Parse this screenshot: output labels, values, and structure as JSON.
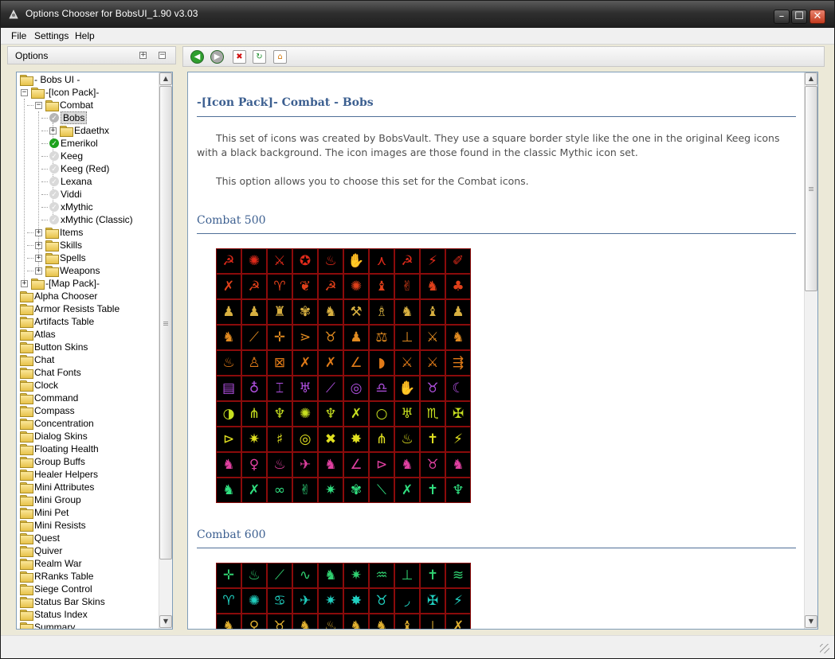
{
  "window": {
    "title": "Options Chooser for BobsUI_1.90 v3.03",
    "buttons": {
      "minimize": "–",
      "maximize": "☐",
      "close": "✕"
    }
  },
  "menu": [
    "File",
    "Settings",
    "Help"
  ],
  "left_panel": {
    "header": "Options",
    "expand_symbol": "+",
    "collapse_symbol": "−",
    "tree": [
      {
        "label": "- Bobs UI -",
        "level": 0
      },
      {
        "label": "-[Icon Pack]-",
        "level": 0,
        "expander": "−"
      },
      {
        "label": "Combat",
        "level": 1,
        "expander": "−"
      },
      {
        "label": "Bobs",
        "level": 2,
        "check": "grey",
        "selected": true
      },
      {
        "label": "Edaethx",
        "level": 2,
        "expander": "+",
        "folder": true
      },
      {
        "label": "Emerikol",
        "level": 2,
        "check": "green"
      },
      {
        "label": "Keeg",
        "level": 2,
        "check": "faint"
      },
      {
        "label": "Keeg (Red)",
        "level": 2,
        "check": "faint"
      },
      {
        "label": "Lexana",
        "level": 2,
        "check": "faint"
      },
      {
        "label": "Viddi",
        "level": 2,
        "check": "faint"
      },
      {
        "label": "xMythic",
        "level": 2,
        "check": "faint"
      },
      {
        "label": "xMythic (Classic)",
        "level": 2,
        "check": "faint"
      },
      {
        "label": "Items",
        "level": 1,
        "expander": "+"
      },
      {
        "label": "Skills",
        "level": 1,
        "expander": "+"
      },
      {
        "label": "Spells",
        "level": 1,
        "expander": "+"
      },
      {
        "label": "Weapons",
        "level": 1,
        "expander": "+"
      },
      {
        "label": "-[Map Pack]-",
        "level": 0,
        "expander": "+"
      },
      {
        "label": "Alpha Chooser",
        "level": 0
      },
      {
        "label": "Armor Resists Table",
        "level": 0
      },
      {
        "label": "Artifacts Table",
        "level": 0
      },
      {
        "label": "Atlas",
        "level": 0
      },
      {
        "label": "Button Skins",
        "level": 0
      },
      {
        "label": "Chat",
        "level": 0
      },
      {
        "label": "Chat Fonts",
        "level": 0
      },
      {
        "label": "Clock",
        "level": 0
      },
      {
        "label": "Command",
        "level": 0
      },
      {
        "label": "Compass",
        "level": 0
      },
      {
        "label": "Concentration",
        "level": 0
      },
      {
        "label": "Dialog Skins",
        "level": 0
      },
      {
        "label": "Floating Health",
        "level": 0
      },
      {
        "label": "Group Buffs",
        "level": 0
      },
      {
        "label": "Healer Helpers",
        "level": 0
      },
      {
        "label": "Mini Attributes",
        "level": 0
      },
      {
        "label": "Mini Group",
        "level": 0
      },
      {
        "label": "Mini Pet",
        "level": 0
      },
      {
        "label": "Mini Resists",
        "level": 0
      },
      {
        "label": "Quest",
        "level": 0
      },
      {
        "label": "Quiver",
        "level": 0
      },
      {
        "label": "Realm War",
        "level": 0
      },
      {
        "label": "RRanks Table",
        "level": 0
      },
      {
        "label": "Siege Control",
        "level": 0
      },
      {
        "label": "Status Bar Skins",
        "level": 0
      },
      {
        "label": "Status Index",
        "level": 0
      },
      {
        "label": "Summary",
        "level": 0
      }
    ]
  },
  "toolbar": [
    {
      "name": "back-icon",
      "glyph": "◀",
      "color": "#2e9e2e"
    },
    {
      "name": "forward-icon",
      "glyph": "▶",
      "color": "#a8a8a8"
    },
    {
      "name": "stop-icon",
      "glyph": "✖",
      "color": "#d01010"
    },
    {
      "name": "refresh-icon",
      "glyph": "↻",
      "color": "#1f8f2f"
    },
    {
      "name": "home-icon",
      "glyph": "⌂",
      "color": "#d47a10"
    }
  ],
  "content": {
    "title": "-[Icon Pack]- Combat - Bobs",
    "paragraph1": "This set of icons was created by BobsVault. They use a square border style like the one in the original Keeg icons with a black background. The icon images are those found in the classic Mythic icon set.",
    "paragraph2": "This option allows you to choose this set for the Combat icons.",
    "section1": "Combat 500",
    "section2": "Combat 600"
  },
  "icon_grid_1": {
    "rows": [
      {
        "color": "#e02a1a",
        "glyphs": [
          "☭",
          "✺",
          "⚔",
          "✪",
          "♨",
          "✋",
          "⋏",
          "☭",
          "⚡",
          "✐"
        ]
      },
      {
        "color": "#e0401a",
        "glyphs": [
          "✗",
          "☭",
          "♈",
          "❦",
          "☭",
          "✺",
          "♝",
          "✌",
          "♞",
          "♣"
        ]
      },
      {
        "color": "#d8b040",
        "glyphs": [
          "♟",
          "♟",
          "♜",
          "✾",
          "♞",
          "⚒",
          "♗",
          "♞",
          "♝",
          "♟"
        ]
      },
      {
        "color": "#e08a20",
        "glyphs": [
          "♞",
          "⟋",
          "✛",
          "⋗",
          "♉",
          "♟",
          "⚖",
          "⊥",
          "⚔",
          "♞"
        ]
      },
      {
        "color": "#e07a18",
        "glyphs": [
          "♨",
          "♙",
          "⊠",
          "✗",
          "✗",
          "∠",
          "◗",
          "⚔",
          "⚔",
          "⇶"
        ]
      },
      {
        "color": "#b050e0",
        "glyphs": [
          "▤",
          "♁",
          "⌶",
          "♅",
          "⟋",
          "◎",
          "♎",
          "✋",
          "♉",
          "☾"
        ]
      },
      {
        "color": "#c8e020",
        "glyphs": [
          "◑",
          "⋔",
          "♆",
          "✺",
          "♆",
          "✗",
          "○",
          "♅",
          "♏",
          "✠"
        ]
      },
      {
        "color": "#e0e020",
        "glyphs": [
          "⊳",
          "✷",
          "♯",
          "◎",
          "✖",
          "✸",
          "⋔",
          "♨",
          "✝",
          "⚡"
        ]
      },
      {
        "color": "#e040a0",
        "glyphs": [
          "♞",
          "♀",
          "♨",
          "✈",
          "♞",
          "∠",
          "⊳",
          "♞",
          "♉",
          "♞"
        ]
      },
      {
        "color": "#30e080",
        "glyphs": [
          "♞",
          "✗",
          "∞",
          "✌",
          "✷",
          "✾",
          "⟍",
          "✗",
          "✝",
          "♆"
        ]
      }
    ]
  },
  "icon_grid_2": {
    "rows": [
      {
        "color": "#30d070",
        "glyphs": [
          "✛",
          "♨",
          "⟋",
          "∿",
          "♞",
          "✷",
          "♒",
          "⊥",
          "✝",
          "≋"
        ]
      },
      {
        "color": "#20d0c0",
        "glyphs": [
          "♈",
          "✺",
          "♋",
          "✈",
          "✷",
          "✸",
          "♉",
          "◞",
          "✠",
          "⚡"
        ]
      },
      {
        "color": "#e0b030",
        "glyphs": [
          "♞",
          "♀",
          "♉",
          "♞",
          "♨",
          "♞",
          "♞",
          "♝",
          "⊥",
          "✗"
        ]
      }
    ]
  }
}
